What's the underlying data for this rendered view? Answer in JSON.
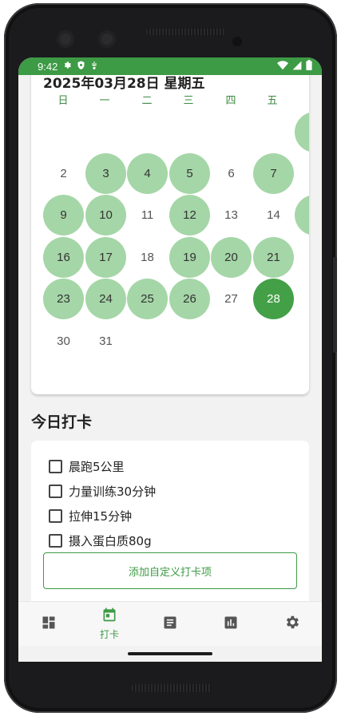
{
  "status_bar": {
    "time": "9:42"
  },
  "calendar": {
    "title": "2025年03月28日 星期五",
    "weekdays": [
      "日",
      "一",
      "二",
      "三",
      "四",
      "五"
    ],
    "rows": [
      [
        "",
        "",
        "",
        "",
        "",
        ""
      ],
      [
        "2",
        "3",
        "4",
        "5",
        "6",
        "7"
      ],
      [
        "9",
        "10",
        "11",
        "12",
        "13",
        "14"
      ],
      [
        "16",
        "17",
        "18",
        "19",
        "20",
        "21"
      ],
      [
        "23",
        "24",
        "25",
        "26",
        "27",
        "28"
      ],
      [
        "30",
        "31",
        "",
        "",
        "",
        ""
      ]
    ],
    "today": "28"
  },
  "today_section": {
    "title": "今日打卡",
    "tasks": [
      {
        "label": "晨跑5公里",
        "checked": false
      },
      {
        "label": "力量训练30分钟",
        "checked": false
      },
      {
        "label": "拉伸15分钟",
        "checked": false
      },
      {
        "label": "摄入蛋白质80g",
        "checked": false
      }
    ],
    "add_button": "添加自定义打卡项"
  },
  "bottom_nav": {
    "items": [
      {
        "icon": "dashboard-icon",
        "label": ""
      },
      {
        "icon": "calendar-icon",
        "label": "打卡"
      },
      {
        "icon": "notes-icon",
        "label": ""
      },
      {
        "icon": "stats-icon",
        "label": ""
      },
      {
        "icon": "settings-gear-icon",
        "label": ""
      }
    ],
    "active_index": 1
  },
  "colors": {
    "accent": "#3d9a45",
    "done_circle": "#a5d6a7",
    "today_circle": "#43a047"
  }
}
